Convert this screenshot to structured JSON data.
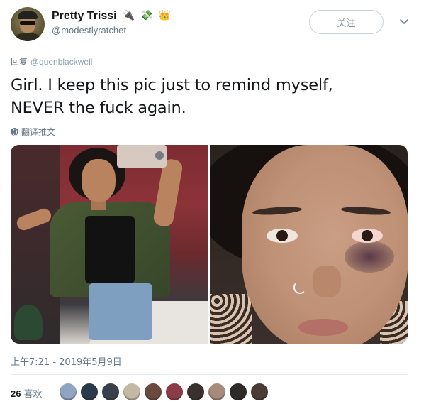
{
  "author": {
    "display_name": "Pretty Trissi",
    "name_emojis": [
      "🔌",
      "💸",
      "👑"
    ],
    "handle": "@modestlyratchet",
    "avatar_icon": "profile-avatar"
  },
  "actions": {
    "follow_label": "关注",
    "more_icon": "chevron-down-icon"
  },
  "reply": {
    "prefix": "回复",
    "mention": "@quenblackwell"
  },
  "tweet": {
    "text_line1": "Girl. I keep this pic just to remind myself,",
    "text_line2": "NEVER the fuck again.",
    "translate_label": "翻译推文"
  },
  "media": {
    "count": 2
  },
  "meta": {
    "timestamp": "上午7:21 - 2019年5月9日"
  },
  "stats": {
    "likes_count": "26",
    "likes_label": "喜欢",
    "liker_avatar_colors": [
      "#8fa5c2",
      "#2b3a4a",
      "#3a3f4c",
      "#c5b9a6",
      "#6b4a3e",
      "#8a3d47",
      "#3a3030",
      "#a68b7a",
      "#2d2a2a",
      "#4a3b36"
    ]
  },
  "colors": {
    "text": "#14171a",
    "muted": "#657786",
    "border": "#e6ecf0"
  }
}
